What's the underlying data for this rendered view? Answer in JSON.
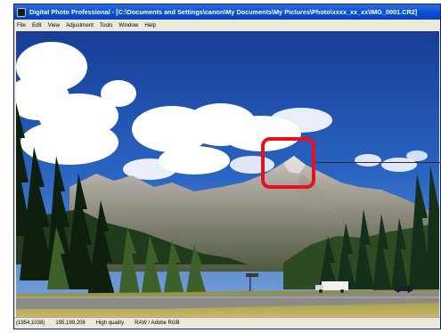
{
  "window": {
    "title": "Digital Photo Professional - [C:\\Documents and Settings\\canon\\My Documents\\My Pictures\\Photo\\xxxx_xx_xx\\IMG_0001.CR2]",
    "icon": "app-icon"
  },
  "menu": {
    "items": [
      {
        "label": "File"
      },
      {
        "label": "Edit"
      },
      {
        "label": "View"
      },
      {
        "label": "Adjustment"
      },
      {
        "label": "Tools"
      },
      {
        "label": "Window"
      },
      {
        "label": "Help"
      }
    ]
  },
  "image": {
    "subject": "mountain landscape photo"
  },
  "status": {
    "coords": "(1954,1038)",
    "rgb": "195,199,208",
    "quality": "High quality",
    "colorspace": "RAW / Adobe RGB"
  },
  "annotation": {
    "highlight_color": "#e8101c"
  }
}
